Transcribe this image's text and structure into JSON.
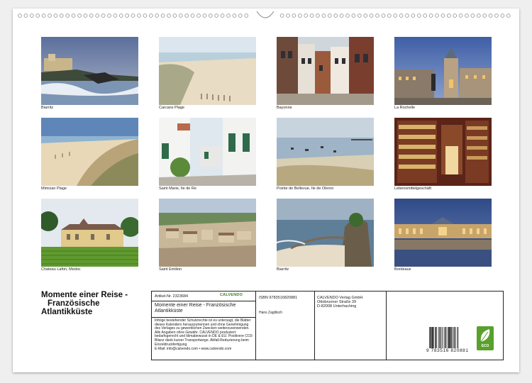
{
  "captions": [
    "Biarritz",
    "Carcans Plage",
    "Bayonne",
    "La Rochelle",
    "Mimizan Plage",
    "Saint Marie, Ile de Re",
    "Pointe de Bellevue, Ile de Oleron",
    "Lebensmittelgeschäft",
    "Chateau Lafon, Medoc",
    "Saint Emilion",
    "Biarritz",
    "Bordeaux"
  ],
  "title": {
    "line1": "Momente einer Reise -",
    "line2": "Französische",
    "line3": "Atlantikküste"
  },
  "info": {
    "article": "Artikel-Nr. 2323684",
    "logo": "CALVENDO",
    "calendar_title": "Momente einer Reise - Französische Atlantikküste",
    "legal": "Infolge bestehender Schutzrechte ist es untersagt, die Blätter dieses Kalenders herauszutrennen und ohne Genehmigung des Verlages zu gewerblichen Zwecken weiterzuverwenden. Alle Angaben ohne Gewähr. CALVENDO produziert bedarfsgerecht und klimabewusst in DE & EU. Positivere CO2-Bilanz dank kurzer Transportwege. Abfall-Reduzierung beim Einzeldruckfertigung.",
    "contact": "E-Mail: info@calvendo.com • www.calvendo.com",
    "isbn": "ISBN 9783516820881",
    "author": "Hans Zaglitsch",
    "publisher1": "CALVENDO Verlag GmbH",
    "publisher2": "Ottobrunner Straße 39",
    "publisher3": "D-82008 Unterhaching",
    "barcode_number": "9 783516 820881",
    "eco_label": "ECO"
  }
}
